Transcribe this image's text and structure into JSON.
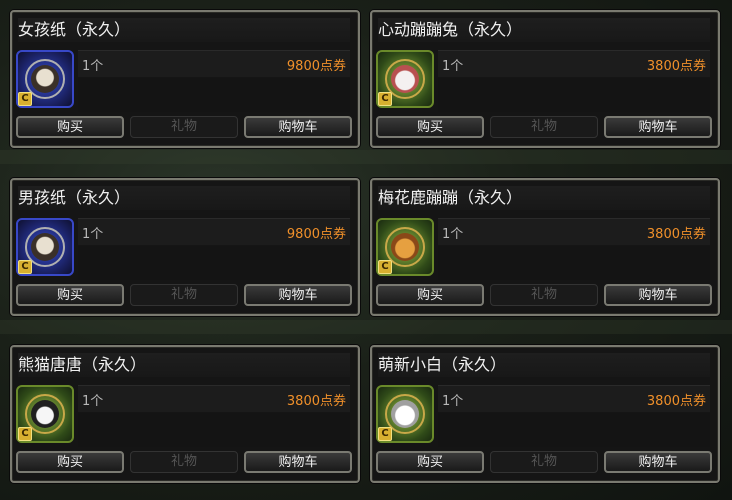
{
  "items": [
    {
      "title": "女孩纸（永久）",
      "quantity": "1个",
      "price": "9800点券",
      "icon": "girl-doll-icon",
      "frame": "blue"
    },
    {
      "title": "心动蹦蹦兔（永久）",
      "quantity": "1个",
      "price": "3800点券",
      "icon": "bunny-icon",
      "frame": "green"
    },
    {
      "title": "男孩纸（永久）",
      "quantity": "1个",
      "price": "9800点券",
      "icon": "boy-doll-icon",
      "frame": "blue"
    },
    {
      "title": "梅花鹿蹦蹦（永久）",
      "quantity": "1个",
      "price": "3800点券",
      "icon": "deer-icon",
      "frame": "green"
    },
    {
      "title": "熊猫唐唐（永久）",
      "quantity": "1个",
      "price": "3800点券",
      "icon": "panda-icon",
      "frame": "green"
    },
    {
      "title": "萌新小白（永久）",
      "quantity": "1个",
      "price": "3800点券",
      "icon": "white-bear-icon",
      "frame": "green"
    }
  ],
  "buttons": {
    "buy": "购买",
    "gift": "礼物",
    "cart": "购物车"
  },
  "coupon_badge": "C",
  "colors": {
    "price": "#f0902a",
    "title": "#f0f0f0",
    "border": "#7a7a70"
  }
}
